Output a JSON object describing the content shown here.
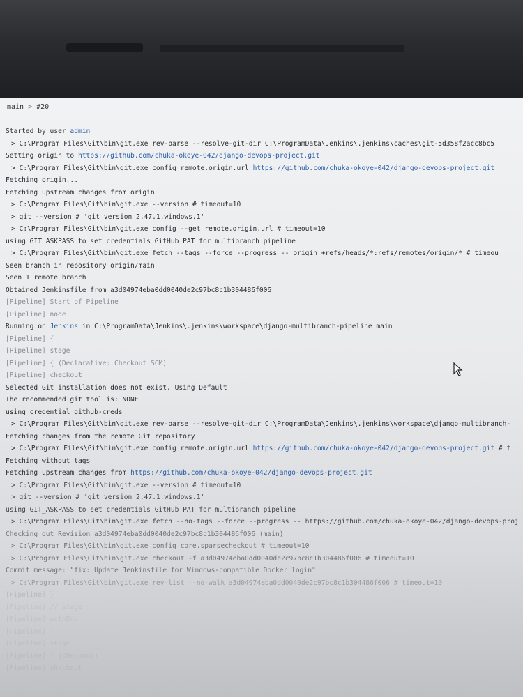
{
  "breadcrumb": {
    "branch": "main",
    "separator": ">",
    "build": "#20"
  },
  "log": [
    {
      "text": "Started by user ",
      "link": "admin",
      "cls": ""
    },
    {
      "text": "> C:\\Program Files\\Git\\bin\\git.exe rev-parse --resolve-git-dir C:\\ProgramData\\Jenkins\\.jenkins\\caches\\git-5d358f2acc8bc5",
      "cls": "cmd"
    },
    {
      "text": "Setting origin to ",
      "link": "https://github.com/chuka-okoye-042/django-devops-project.git",
      "cls": ""
    },
    {
      "text": "> C:\\Program Files\\Git\\bin\\git.exe config remote.origin.url ",
      "link": "https://github.com/chuka-okoye-042/django-devops-project.git",
      "cls": "cmd"
    },
    {
      "text": "Fetching origin...",
      "cls": ""
    },
    {
      "text": "Fetching upstream changes from origin",
      "cls": ""
    },
    {
      "text": "> C:\\Program Files\\Git\\bin\\git.exe --version # timeout=10",
      "cls": "cmd"
    },
    {
      "text": "> git --version # 'git version 2.47.1.windows.1'",
      "cls": "cmd"
    },
    {
      "text": "> C:\\Program Files\\Git\\bin\\git.exe config --get remote.origin.url # timeout=10",
      "cls": "cmd"
    },
    {
      "text": "using GIT_ASKPASS to set credentials GitHub PAT for multibranch pipeline",
      "cls": ""
    },
    {
      "text": "> C:\\Program Files\\Git\\bin\\git.exe fetch --tags --force --progress -- origin +refs/heads/*:refs/remotes/origin/* # timeou",
      "cls": "cmd"
    },
    {
      "text": "Seen branch in repository origin/main",
      "cls": ""
    },
    {
      "text": "Seen 1 remote branch",
      "cls": ""
    },
    {
      "text": "Obtained Jenkinsfile from a3d04974eba0dd0040de2c97bc8c1b304486f006",
      "cls": ""
    },
    {
      "text": "[Pipeline] Start of Pipeline",
      "cls": "pipe"
    },
    {
      "text": "[Pipeline] node",
      "cls": "pipe"
    },
    {
      "text": "Running on ",
      "link": "Jenkins",
      "tail": " in C:\\ProgramData\\Jenkins\\.jenkins\\workspace\\django-multibranch-pipeline_main",
      "cls": ""
    },
    {
      "text": "[Pipeline] {",
      "cls": "pipe"
    },
    {
      "text": "[Pipeline] stage",
      "cls": "pipe"
    },
    {
      "text": "[Pipeline] { (Declarative: Checkout SCM)",
      "cls": "pipe"
    },
    {
      "text": "[Pipeline] checkout",
      "cls": "pipe"
    },
    {
      "text": "Selected Git installation does not exist. Using Default",
      "cls": ""
    },
    {
      "text": "The recommended git tool is: NONE",
      "cls": ""
    },
    {
      "text": "using credential github-creds",
      "cls": ""
    },
    {
      "text": "> C:\\Program Files\\Git\\bin\\git.exe rev-parse --resolve-git-dir C:\\ProgramData\\Jenkins\\.jenkins\\workspace\\django-multibranch-",
      "cls": "cmd"
    },
    {
      "text": "Fetching changes from the remote Git repository",
      "cls": ""
    },
    {
      "text": "> C:\\Program Files\\Git\\bin\\git.exe config remote.origin.url ",
      "link": "https://github.com/chuka-okoye-042/django-devops-project.git",
      "tail": " # t",
      "cls": "cmd"
    },
    {
      "text": "Fetching without tags",
      "cls": ""
    },
    {
      "text": "Fetching upstream changes from ",
      "link": "https://github.com/chuka-okoye-042/django-devops-project.git",
      "cls": ""
    },
    {
      "text": "> C:\\Program Files\\Git\\bin\\git.exe --version # timeout=10",
      "cls": "cmd fade1"
    },
    {
      "text": "> git --version # 'git version 2.47.1.windows.1'",
      "cls": "cmd fade1"
    },
    {
      "text": "using GIT_ASKPASS to set credentials GitHub PAT for multibranch pipeline",
      "cls": "fade1"
    },
    {
      "text": "> C:\\Program Files\\Git\\bin\\git.exe fetch --no-tags --force --progress -- https://github.com/chuka-okoye-042/django-devops-proj",
      "cls": "cmd fade1"
    },
    {
      "text": "Checking out Revision a3d04974eba0dd0040de2c97bc8c1b304486f006 (main)",
      "cls": "fade2"
    },
    {
      "text": "> C:\\Program Files\\Git\\bin\\git.exe config core.sparsecheckout # timeout=10",
      "cls": "cmd fade2"
    },
    {
      "text": "> C:\\Program Files\\Git\\bin\\git.exe checkout -f a3d04974eba0dd0040de2c97bc8c1b304486f006 # timeout=10",
      "cls": "cmd fade2"
    },
    {
      "text": "Commit message: \"fix: Update Jenkinsfile for Windows-compatible Docker login\"",
      "cls": "fade2"
    },
    {
      "text": "> C:\\Program Files\\Git\\bin\\git.exe rev-list --no-walk a3d04974eba0dd0040de2c97bc8c1b304486f006 # timeout=10",
      "cls": "cmd fade3"
    },
    {
      "text": "[Pipeline] }",
      "cls": "pipe fade3"
    },
    {
      "text": "[Pipeline] // stage",
      "cls": "pipe fade4"
    },
    {
      "text": "[Pipeline] withEnv",
      "cls": "pipe fade4"
    },
    {
      "text": "[Pipeline] {",
      "cls": "pipe fade4"
    },
    {
      "text": "[Pipeline] stage",
      "cls": "pipe fade4"
    },
    {
      "text": "[Pipeline] { (Checkout)",
      "cls": "pipe fade4"
    },
    {
      "text": "[Pipeline] checkout",
      "cls": "pipe fade4"
    }
  ]
}
